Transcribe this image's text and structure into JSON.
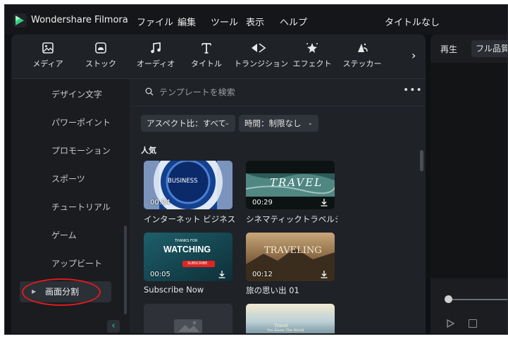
{
  "app": {
    "name": "Wondershare Filmora",
    "document_title": "タイトルなし"
  },
  "menu": [
    "ファイル",
    "編集",
    "ツール",
    "表示",
    "ヘルプ"
  ],
  "toolbar": {
    "items": [
      {
        "label": "メディア",
        "icon": "media-icon"
      },
      {
        "label": "ストック",
        "icon": "stock-icon"
      },
      {
        "label": "オーディオ",
        "icon": "audio-icon"
      },
      {
        "label": "タイトル",
        "icon": "title-icon"
      },
      {
        "label": "トランジション",
        "icon": "transition-icon"
      },
      {
        "label": "エフェクト",
        "icon": "effect-icon"
      },
      {
        "label": "ステッカー",
        "icon": "sticker-icon"
      }
    ],
    "next_glyph": "›"
  },
  "sidebar": {
    "items": [
      {
        "label": "デザイン文字"
      },
      {
        "label": "パワーポイント"
      },
      {
        "label": "プロモーション"
      },
      {
        "label": "スポーツ"
      },
      {
        "label": "チュートリアル"
      },
      {
        "label": "ゲーム"
      },
      {
        "label": "アップビート"
      },
      {
        "label": "画面分割",
        "selected": true
      }
    ],
    "collapse_glyph": "‹"
  },
  "search": {
    "placeholder": "テンプレートを検索",
    "more_glyph": "•••"
  },
  "filters": [
    {
      "label": "アスペクト比：すべて"
    },
    {
      "label": "時間：制限なし"
    }
  ],
  "section": {
    "title": "人気"
  },
  "templates": [
    {
      "title": "インターネット ビジネス サ...",
      "duration": "00:24",
      "thumb_text": "BUSINESS",
      "downloadable": false
    },
    {
      "title": "シネマティックトラベルシュ...",
      "duration": "00:29",
      "thumb_text": "TRAVEL",
      "downloadable": true
    },
    {
      "title": "Subscribe Now",
      "duration": "00:05",
      "thumb_small": "THANKS FOR",
      "thumb_text": "WATCHING",
      "thumb_button": "SUBSCRIBE",
      "downloadable": true
    },
    {
      "title": "旅の思い出 01",
      "duration": "00:12",
      "thumb_text": "TRAVELING",
      "downloadable": true
    },
    {
      "title": "",
      "duration": "",
      "downloadable": false
    },
    {
      "title": "",
      "duration": "",
      "thumb_line1": "Travel",
      "thumb_line2": "You Know The World",
      "downloadable": false
    }
  ],
  "preview": {
    "tab_playback": "再生",
    "quality": "フル品質"
  },
  "colors": {
    "accent_green": "#35d07f",
    "annotation_red": "#e01b1b",
    "panel_bg": "#1f2227"
  }
}
